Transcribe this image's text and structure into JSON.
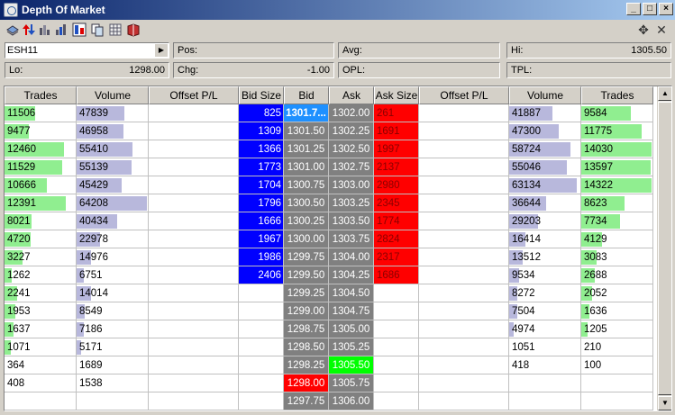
{
  "window": {
    "title": "Depth Of Market"
  },
  "toolbar": {
    "icons": [
      "layers-icon",
      "up-down-arrows-icon",
      "bars-icon",
      "bars-alt-icon",
      "chart-blocks-icon",
      "copy-icon",
      "grid-icon",
      "book-icon"
    ],
    "right_icons": [
      "move-icon",
      "tools-icon"
    ]
  },
  "info": {
    "symbol": "ESH11",
    "pos_label": "Pos:",
    "pos_value": "",
    "avg_label": "Avg:",
    "avg_value": "",
    "hi_label": "Hi:",
    "hi_value": "1305.50",
    "lo_label": "Lo:",
    "lo_value": "1298.00",
    "chg_label": "Chg:",
    "chg_value": "-1.00",
    "opl_label": "OPL:",
    "opl_value": "",
    "tpl_label": "TPL:",
    "tpl_value": ""
  },
  "columns": [
    "Trades",
    "Volume",
    "Offset P/L",
    "Bid Size",
    "Bid",
    "Ask",
    "Ask Size",
    "Offset P/L",
    "Volume",
    "Trades"
  ],
  "colors": {
    "bid_size": "#0000ff",
    "ask_size": "#ff0000",
    "price": "#808080",
    "last_bid": "#1e90ff",
    "hi": "#00ff00",
    "lo": "#ff0000",
    "bar_trades": "#90ee90",
    "bar_volume": "#b8b8dc"
  },
  "rows": [
    {
      "lt": "11506",
      "lv": "47839",
      "bs": "825",
      "bid": "1301.7...",
      "ask": "1302.00",
      "as": "261",
      "rv": "41887",
      "rt": "9584",
      "lt_f": 0.43,
      "lv_f": 0.68,
      "rv_f": 0.62,
      "rt_f": 0.7
    },
    {
      "lt": "9477",
      "lv": "46958",
      "bs": "1309",
      "bid": "1301.50",
      "ask": "1302.25",
      "as": "1691",
      "rv": "47300",
      "rt": "11775",
      "lt_f": 0.35,
      "lv_f": 0.67,
      "rv_f": 0.7,
      "rt_f": 0.86
    },
    {
      "lt": "12460",
      "lv": "55410",
      "bs": "1366",
      "bid": "1301.25",
      "ask": "1302.50",
      "as": "1997",
      "rv": "58724",
      "rt": "14030",
      "lt_f": 0.85,
      "lv_f": 0.8,
      "rv_f": 0.87,
      "rt_f": 1.0
    },
    {
      "lt": "11529",
      "lv": "55139",
      "bs": "1773",
      "bid": "1301.00",
      "ask": "1302.75",
      "as": "2137",
      "rv": "55046",
      "rt": "13597",
      "lt_f": 0.82,
      "lv_f": 0.78,
      "rv_f": 0.82,
      "rt_f": 0.99
    },
    {
      "lt": "10666",
      "lv": "45429",
      "bs": "1704",
      "bid": "1300.75",
      "ask": "1303.00",
      "as": "2980",
      "rv": "63134",
      "rt": "14322",
      "lt_f": 0.6,
      "lv_f": 0.64,
      "rv_f": 0.96,
      "rt_f": 1.0
    },
    {
      "lt": "12391",
      "lv": "64208",
      "bs": "1796",
      "bid": "1300.50",
      "ask": "1303.25",
      "as": "2345",
      "rv": "36644",
      "rt": "8623",
      "lt_f": 0.87,
      "lv_f": 1.0,
      "rv_f": 0.52,
      "rt_f": 0.62
    },
    {
      "lt": "8021",
      "lv": "40434",
      "bs": "1666",
      "bid": "1300.25",
      "ask": "1303.50",
      "as": "1774",
      "rv": "29203",
      "rt": "7734",
      "lt_f": 0.39,
      "lv_f": 0.58,
      "rv_f": 0.41,
      "rt_f": 0.55
    },
    {
      "lt": "4720",
      "lv": "22978",
      "bs": "1967",
      "bid": "1300.00",
      "ask": "1303.75",
      "as": "2824",
      "rv": "16414",
      "rt": "4129",
      "lt_f": 0.37,
      "lv_f": 0.33,
      "rv_f": 0.23,
      "rt_f": 0.29
    },
    {
      "lt": "3227",
      "lv": "14976",
      "bs": "1986",
      "bid": "1299.75",
      "ask": "1304.00",
      "as": "2317",
      "rv": "13512",
      "rt": "3083",
      "lt_f": 0.26,
      "lv_f": 0.21,
      "rv_f": 0.19,
      "rt_f": 0.22
    },
    {
      "lt": "1262",
      "lv": "6751",
      "bs": "2406",
      "bid": "1299.50",
      "ask": "1304.25",
      "as": "1686",
      "rv": "9534",
      "rt": "2688",
      "lt_f": 0.1,
      "lv_f": 0.1,
      "rv_f": 0.14,
      "rt_f": 0.19
    },
    {
      "lt": "2241",
      "lv": "14014",
      "bs": "",
      "bid": "1299.25",
      "ask": "1304.50",
      "as": "",
      "rv": "8272",
      "rt": "2052",
      "lt_f": 0.18,
      "lv_f": 0.2,
      "rv_f": 0.12,
      "rt_f": 0.15
    },
    {
      "lt": "1953",
      "lv": "8549",
      "bs": "",
      "bid": "1299.00",
      "ask": "1304.75",
      "as": "",
      "rv": "7504",
      "rt": "1636",
      "lt_f": 0.16,
      "lv_f": 0.12,
      "rv_f": 0.11,
      "rt_f": 0.12
    },
    {
      "lt": "1637",
      "lv": "7186",
      "bs": "",
      "bid": "1298.75",
      "ask": "1305.00",
      "as": "",
      "rv": "4974",
      "rt": "1205",
      "lt_f": 0.13,
      "lv_f": 0.1,
      "rv_f": 0.07,
      "rt_f": 0.09
    },
    {
      "lt": "1071",
      "lv": "5171",
      "bs": "",
      "bid": "1298.50",
      "ask": "1305.25",
      "as": "",
      "rv": "1051",
      "rt": "210",
      "lt_f": 0.09,
      "lv_f": 0.07,
      "rv_f": 0.0,
      "rt_f": 0.0
    },
    {
      "lt": "364",
      "lv": "1689",
      "bs": "",
      "bid": "1298.25",
      "ask": "1305.50",
      "as": "",
      "rv": "418",
      "rt": "100",
      "lt_f": 0.0,
      "lv_f": 0.0,
      "rv_f": 0.0,
      "rt_f": 0.0
    },
    {
      "lt": "408",
      "lv": "1538",
      "bs": "",
      "bid": "1298.00",
      "ask": "1305.75",
      "as": "",
      "rv": "",
      "rt": "",
      "lt_f": 0.0,
      "lv_f": 0.0,
      "rv_f": 0.0,
      "rt_f": 0.0
    },
    {
      "lt": "",
      "lv": "",
      "bs": "",
      "bid": "1297.75",
      "ask": "1306.00",
      "as": "",
      "rv": "",
      "rt": "",
      "lt_f": 0.0,
      "lv_f": 0.0,
      "rv_f": 0.0,
      "rt_f": 0.0
    }
  ]
}
